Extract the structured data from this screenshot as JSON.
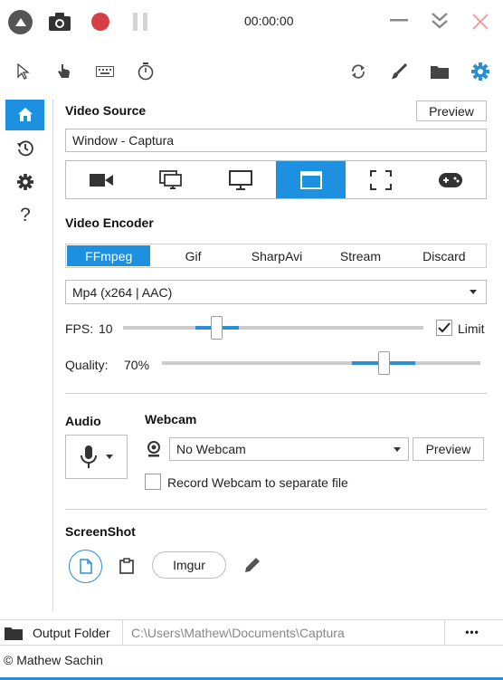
{
  "titlebar": {
    "timer": "00:00:00"
  },
  "toolbar": {
    "left_icons": [
      "cursor-icon",
      "click-hand-icon",
      "keyboard-icon",
      "stopwatch-icon"
    ],
    "right_icons": [
      "refresh-icon",
      "brush-icon",
      "folder-icon",
      "settings-icon"
    ]
  },
  "nav": {
    "items": [
      "home-icon",
      "history-icon",
      "gear-icon",
      "help-icon"
    ],
    "help_glyph": "?"
  },
  "video_source": {
    "heading": "Video Source",
    "preview_label": "Preview",
    "value": "Window  -  Captura",
    "tabs": [
      "camera-icon",
      "multi-screen-icon",
      "monitor-icon",
      "window-icon",
      "region-icon",
      "gamepad-icon"
    ],
    "active_tab": 3
  },
  "video_encoder": {
    "heading": "Video Encoder",
    "tabs": [
      "FFmpeg",
      "Gif",
      "SharpAvi",
      "Stream",
      "Discard"
    ],
    "active_tab": 0,
    "codec": "Mp4 (x264 | AAC)",
    "fps_label": "FPS:",
    "fps_value": "10",
    "limit_label": "Limit",
    "limit_checked": true,
    "quality_label": "Quality:",
    "quality_value": "70%"
  },
  "audio": {
    "heading": "Audio"
  },
  "webcam": {
    "heading": "Webcam",
    "selected": "No Webcam",
    "preview_label": "Preview",
    "separate_file_label": "Record Webcam to separate file",
    "separate_file_checked": false
  },
  "screenshot": {
    "heading": "ScreenShot",
    "imgur_label": "Imgur"
  },
  "output": {
    "label": "Output Folder",
    "path": "C:\\Users\\Mathew\\Documents\\Captura",
    "more_label": "•••"
  },
  "footer": {
    "copyright": "© Mathew Sachin"
  },
  "colors": {
    "accent": "#1e90e0",
    "record": "#d64045",
    "close": "#f0a0a0"
  }
}
